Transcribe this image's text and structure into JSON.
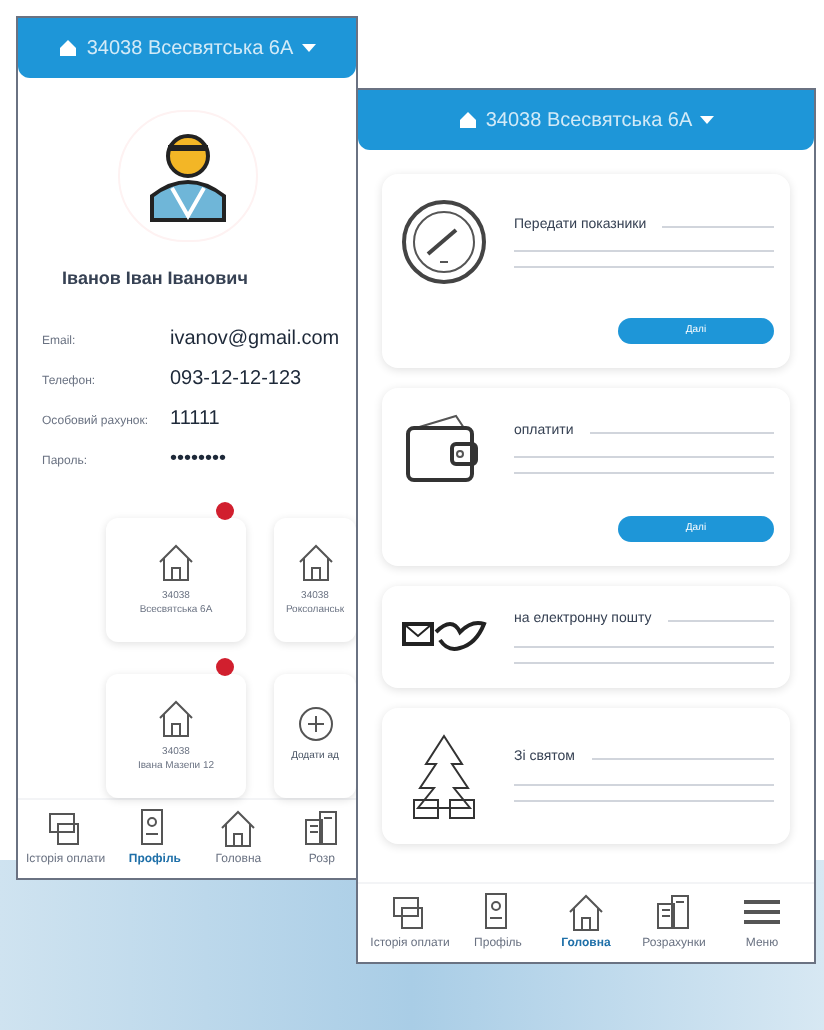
{
  "left_screen": {
    "header": {
      "address": "34038 Всесвятська 6А"
    },
    "profile": {
      "name": "Іванов Іван Іванович",
      "fields": [
        {
          "label": "Email:",
          "value": "ivanov@gmail.com"
        },
        {
          "label": "Телефон:",
          "value": "093-12-12-123"
        },
        {
          "label": "Особовий рахунок:",
          "value": "11111"
        },
        {
          "label": "Пароль:",
          "value": "••••••••"
        }
      ]
    },
    "addresses": [
      {
        "kind": "address",
        "line_1": "34038",
        "line_2": "Всесвятська 6А",
        "notification": true
      },
      {
        "kind": "address",
        "line_1": "34038",
        "line_2": "Роксоланськ"
      },
      {
        "kind": "address",
        "line_1": "34038",
        "line_2": "Івана Мазепи 12",
        "notification": true
      },
      {
        "kind": "add",
        "label": "Додати ад"
      }
    ],
    "nav": [
      {
        "label": "Історія оплати",
        "selected": false
      },
      {
        "label": "Профіль",
        "selected": true
      },
      {
        "label": "Головна",
        "selected": false
      },
      {
        "label": "Розр",
        "selected": false
      }
    ]
  },
  "right_screen": {
    "header": {
      "address": "34038 Всесвятська 6А"
    },
    "cards": [
      {
        "kind": "meter",
        "title": "Передати показники",
        "button": "Далі"
      },
      {
        "kind": "wallet",
        "title": "оплатити",
        "button": "Далі"
      },
      {
        "kind": "mail",
        "title": "на електронну пошту"
      },
      {
        "kind": "holiday",
        "title": "Зі святом"
      }
    ],
    "nav": [
      {
        "label": "Історія оплати",
        "selected": false
      },
      {
        "label": "Профіль",
        "selected": false
      },
      {
        "label": "Головна",
        "selected": true
      },
      {
        "label": "Розрахунки",
        "selected": false
      },
      {
        "label": "Меню",
        "selected": false
      }
    ]
  }
}
